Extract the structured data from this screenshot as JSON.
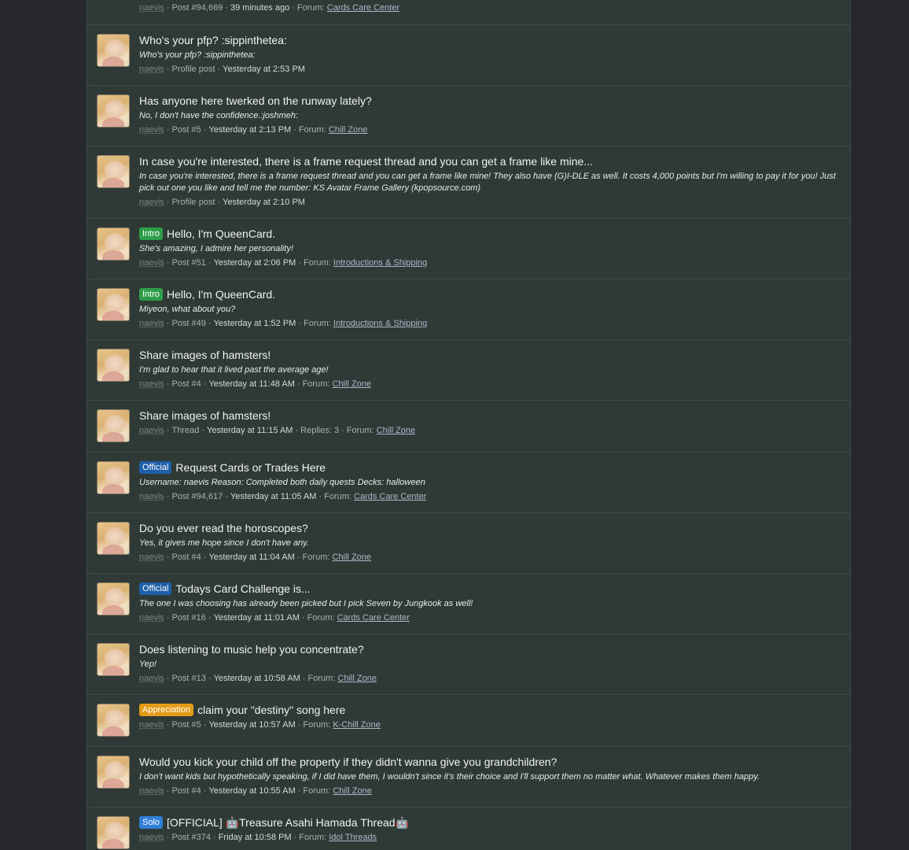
{
  "badge_colors": {
    "Intro": "#2e9e4a",
    "Official": "#1f5fa8",
    "Appreciation": "#e39b16",
    "Solo": "#2f7fd8"
  },
  "items": [
    {
      "title": "",
      "badge": "",
      "snippet": "",
      "user": "naevis",
      "type": "Post #94,669",
      "time": "39 minutes ago",
      "forum_label": "Forum:",
      "forum": "Cards Care Center",
      "extra": ""
    },
    {
      "title": "Who's your pfp? :sippinthetea:",
      "badge": "",
      "snippet": "Who's your pfp? :sippinthetea:",
      "user": "naevis",
      "type": "Profile post",
      "time": "Yesterday at 2:53 PM",
      "forum_label": "",
      "forum": "",
      "extra": ""
    },
    {
      "title": "Has anyone here twerked on the runway lately?",
      "badge": "",
      "snippet": "No, I don't have the confidence.:joshmeh:",
      "user": "naevis",
      "type": "Post #5",
      "time": "Yesterday at 2:13 PM",
      "forum_label": "Forum:",
      "forum": "Chill Zone",
      "extra": ""
    },
    {
      "title": "In case you're interested, there is a frame request thread and you can get a frame like mine...",
      "badge": "",
      "snippet": "In case you're interested, there is a frame request thread and you can get a frame like mine! They also have (G)I-DLE as well. It costs 4,000 points but I'm willing to pay it for you! Just pick out one you like and tell me the number: KS Avatar Frame Gallery (kpopsource.com)",
      "user": "naevis",
      "type": "Profile post",
      "time": "Yesterday at 2:10 PM",
      "forum_label": "",
      "forum": "",
      "extra": ""
    },
    {
      "title": "Hello, I'm QueenCard.",
      "badge": "Intro",
      "snippet": "She's amazing, I admire her personality!",
      "user": "naevis",
      "type": "Post #51",
      "time": "Yesterday at 2:06 PM",
      "forum_label": "Forum:",
      "forum": "Introductions & Shipping",
      "extra": ""
    },
    {
      "title": "Hello, I'm QueenCard.",
      "badge": "Intro",
      "snippet": "Miyeon, what about you?",
      "user": "naevis",
      "type": "Post #49",
      "time": "Yesterday at 1:52 PM",
      "forum_label": "Forum:",
      "forum": "Introductions & Shipping",
      "extra": ""
    },
    {
      "title": "Share images of hamsters!",
      "badge": "",
      "snippet": "I'm glad to hear that it lived past the average age!",
      "user": "naevis",
      "type": "Post #4",
      "time": "Yesterday at 11:48 AM",
      "forum_label": "Forum:",
      "forum": "Chill Zone",
      "extra": ""
    },
    {
      "title": "Share images of hamsters!",
      "badge": "",
      "snippet": "",
      "user": "naevis",
      "type": "Thread",
      "time": "Yesterday at 11:15 AM",
      "forum_label": "Forum:",
      "forum": "Chill Zone",
      "extra": "Replies: 3"
    },
    {
      "title": "Request Cards or Trades Here",
      "badge": "Official",
      "snippet": "Username: naevis Reason: Completed both daily quests Decks: halloween",
      "user": "naevis",
      "type": "Post #94,617",
      "time": "Yesterday at 11:05 AM",
      "forum_label": "Forum:",
      "forum": "Cards Care Center",
      "extra": ""
    },
    {
      "title": "Do you ever read the horoscopes?",
      "badge": "",
      "snippet": "Yes, it gives me hope since I don't have any.",
      "user": "naevis",
      "type": "Post #4",
      "time": "Yesterday at 11:04 AM",
      "forum_label": "Forum:",
      "forum": "Chill Zone",
      "extra": ""
    },
    {
      "title": "Todays Card Challenge is...",
      "badge": "Official",
      "snippet": "The one I was choosing has already been picked but I pick Seven by Jungkook as well!",
      "user": "naevis",
      "type": "Post #16",
      "time": "Yesterday at 11:01 AM",
      "forum_label": "Forum:",
      "forum": "Cards Care Center",
      "extra": ""
    },
    {
      "title": "Does listening to music help you concentrate?",
      "badge": "",
      "snippet": "Yep!",
      "user": "naevis",
      "type": "Post #13",
      "time": "Yesterday at 10:58 AM",
      "forum_label": "Forum:",
      "forum": "Chill Zone",
      "extra": ""
    },
    {
      "title": "claim your \"destiny\" song here",
      "badge": "Appreciation",
      "snippet": "",
      "user": "naevis",
      "type": "Post #5",
      "time": "Yesterday at 10:57 AM",
      "forum_label": "Forum:",
      "forum": "K-Chill Zone",
      "extra": ""
    },
    {
      "title": "Would you kick your child off the property if they didn't wanna give you grandchildren?",
      "badge": "",
      "snippet": "I don't want kids but hypothetically speaking, if I did have them, I wouldn't since it's their choice and I'll support them no matter what. Whatever makes them happy.",
      "user": "naevis",
      "type": "Post #4",
      "time": "Yesterday at 10:55 AM",
      "forum_label": "Forum:",
      "forum": "Chill Zone",
      "extra": ""
    },
    {
      "title": "[OFFICIAL] 🤖Treasure Asahi Hamada Thread🤖",
      "badge": "Solo",
      "snippet": "",
      "user": "naevis",
      "type": "Post #374",
      "time": "Friday at 10:58 PM",
      "forum_label": "Forum:",
      "forum": "Idol Threads",
      "extra": ""
    }
  ]
}
